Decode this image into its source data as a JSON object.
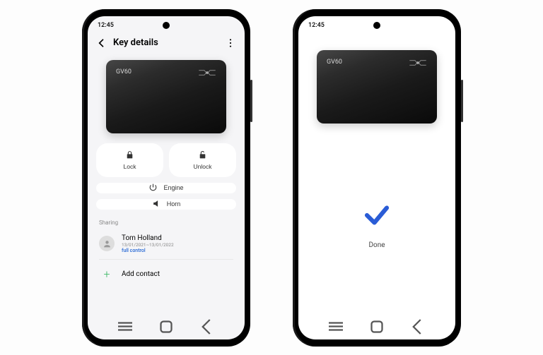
{
  "status": {
    "time": "12:45"
  },
  "phone1": {
    "header": {
      "title": "Key details"
    },
    "card": {
      "model": "GV60"
    },
    "actions": {
      "lock": "Lock",
      "unlock": "Unlock",
      "engine": "Engine",
      "horn": "Horn"
    },
    "sharing": {
      "label": "Sharing",
      "contact": {
        "name": "Tom Holland",
        "dates": "13/01/2021~13/01/2022",
        "permission": "full control"
      },
      "add": "Add contact"
    }
  },
  "phone2": {
    "card": {
      "model": "GV60"
    },
    "done": "Done"
  }
}
